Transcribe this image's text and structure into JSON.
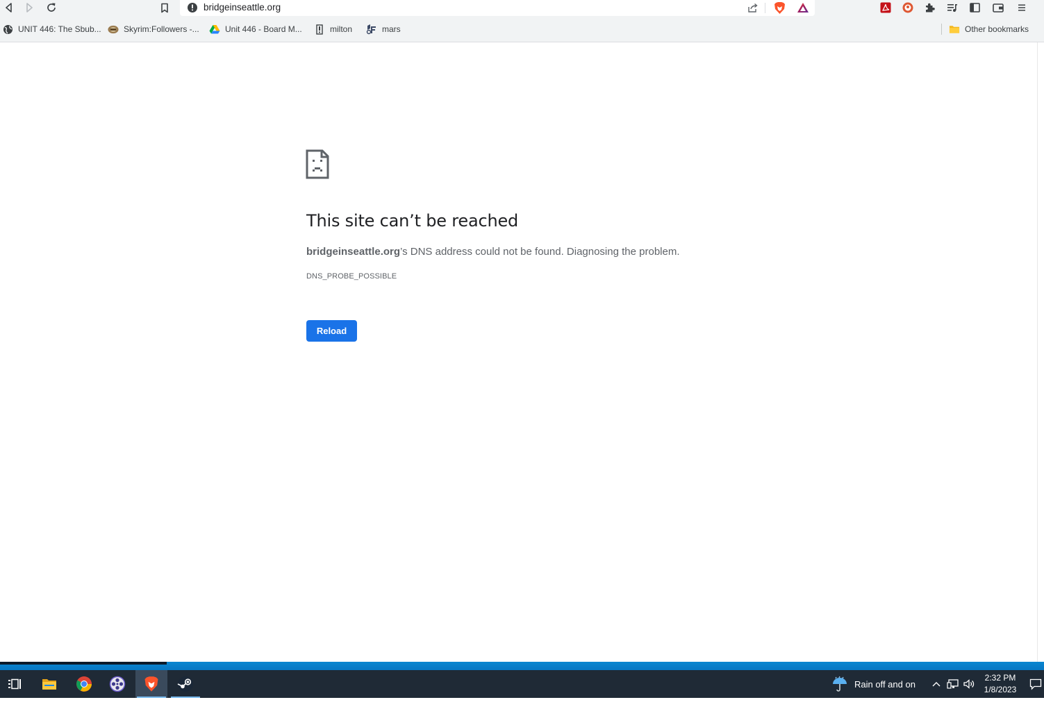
{
  "browser": {
    "url": "bridgeinseattle.org",
    "bookmarks": [
      {
        "label": "UNIT 446: The Sbub..."
      },
      {
        "label": "Skyrim:Followers -..."
      },
      {
        "label": "Unit 446 - Board M..."
      },
      {
        "label": "milton"
      },
      {
        "label": "mars"
      }
    ],
    "other_bookmarks": "Other bookmarks"
  },
  "error_page": {
    "title": "This site can’t be reached",
    "domain": "bridgeinseattle.org",
    "message_rest": "’s DNS address could not be found. Diagnosing the problem.",
    "error_code": "DNS_PROBE_POSSIBLE",
    "reload_label": "Reload"
  },
  "taskbar": {
    "weather": "Rain off and on",
    "time": "2:32 PM",
    "date": "1/8/2023"
  },
  "colors": {
    "accent": "#1a73e8",
    "taskbar": "#1f2a36",
    "brave_orange": "#fb542b"
  }
}
